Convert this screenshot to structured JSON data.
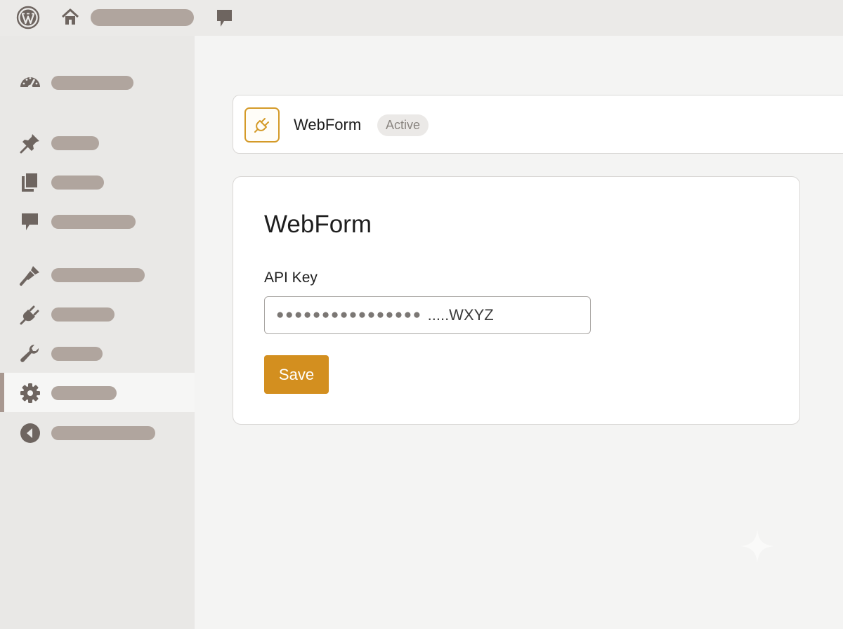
{
  "topbar": {
    "logo_icon": "wordpress-logo-icon",
    "home_icon": "home-icon",
    "site_name": "",
    "comments_icon": "comment-icon"
  },
  "sidebar": {
    "items": [
      {
        "icon": "dashboard-gauge-icon",
        "label": ""
      },
      {
        "icon": "pushpin-icon",
        "label": ""
      },
      {
        "icon": "pages-icon",
        "label": ""
      },
      {
        "icon": "comment-icon",
        "label": ""
      },
      {
        "icon": "paintbrush-icon",
        "label": ""
      },
      {
        "icon": "plugin-icon",
        "label": ""
      },
      {
        "icon": "wrench-icon",
        "label": ""
      },
      {
        "icon": "gear-icon",
        "label": "",
        "current": true
      },
      {
        "icon": "collapse-arrow-icon",
        "label": ""
      }
    ]
  },
  "plugin_header": {
    "name": "WebForm",
    "status": "Active",
    "icon": "plug-icon",
    "accent_color": "#d49a28"
  },
  "settings": {
    "title": "WebForm",
    "api_key": {
      "label": "API Key",
      "masked_value": "●●●●●●●●●●●●●●●●",
      "visible_suffix": ".....WXYZ"
    },
    "save_label": "Save",
    "button_color": "#d38f1f"
  }
}
